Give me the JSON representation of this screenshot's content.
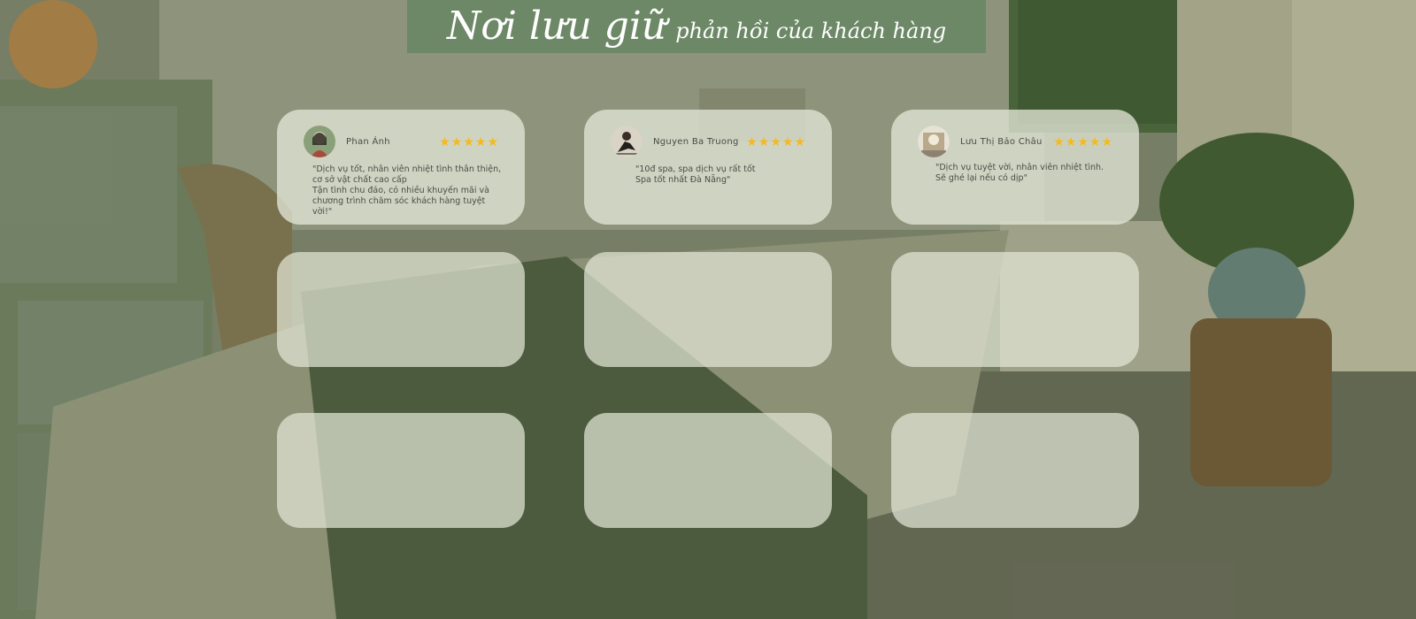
{
  "header": {
    "title_main": "Nơi lưu giữ",
    "title_sub": "phản hồi của khách hàng"
  },
  "colors": {
    "header_bg": "#6c8866",
    "card_bg": "#e2e6d6",
    "star": "#f6b91a"
  },
  "reviews": [
    {
      "name": "Phan Ánh",
      "rating": 5,
      "lines": [
        "\"Dịch vụ tốt, nhân viên nhiệt tình thân thiện,",
        "cơ sở vật chất cao cấp",
        "Tận tình chu đáo, có nhiều khuyến mãi và",
        "chương trình chăm sóc khách hàng tuyệt vời!\""
      ]
    },
    {
      "name": "Nguyen Ba Truong",
      "rating": 5,
      "lines": [
        "\"10đ spa, spa dịch vụ rất tốt",
        "Spa tốt nhất Đà Nẵng\""
      ]
    },
    {
      "name": "Lưu Thị Bảo Châu",
      "rating": 5,
      "lines": [
        "\"Dịch vụ tuyệt vời, nhân viên nhiệt tình.",
        "Sẽ ghé lại nếu có dịp\""
      ]
    }
  ],
  "star_glyph": "★"
}
